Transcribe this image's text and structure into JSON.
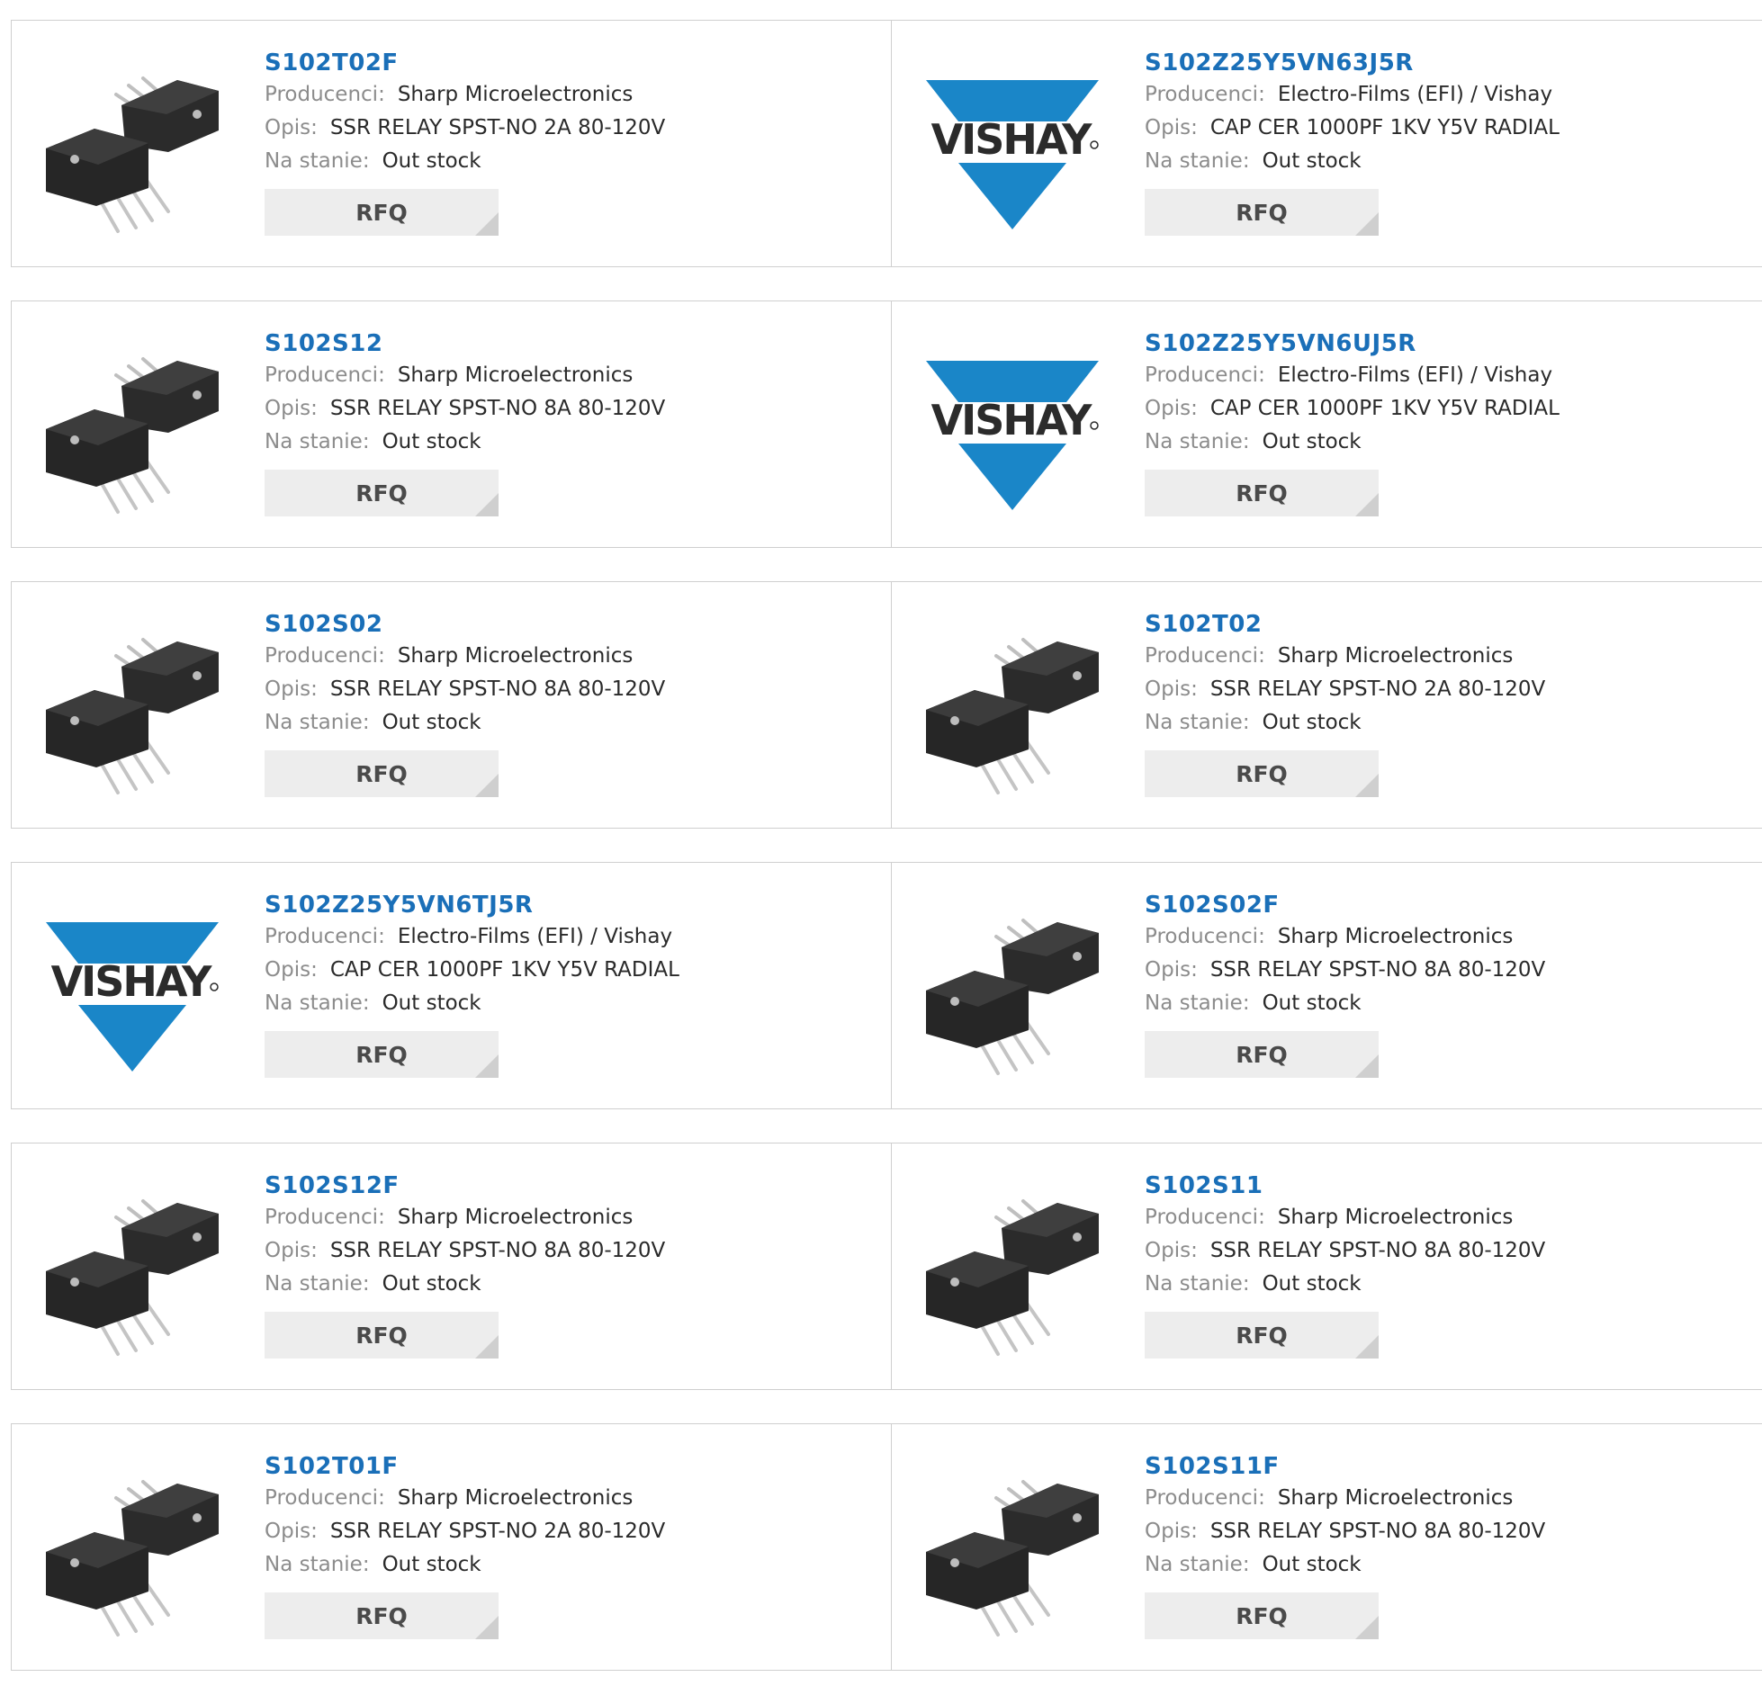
{
  "labels": {
    "producer": "Producenci:",
    "description": "Opis:",
    "stock": "Na stanie:",
    "rfq": "RFQ"
  },
  "brand": {
    "vishay_text": "VISHAY",
    "vishay_blue": "#1a86c8"
  },
  "products": [
    {
      "part": "S102T02F",
      "producer": "Sharp Microelectronics",
      "description": "SSR RELAY SPST-NO 2A 80-120V",
      "stock": "Out stock",
      "image": "relay-package-icon"
    },
    {
      "part": "S102Z25Y5VN63J5R",
      "producer": "Electro-Films (EFI) / Vishay",
      "description": "CAP CER 1000PF 1KV Y5V RADIAL",
      "stock": "Out stock",
      "image": "vishay-logo"
    },
    {
      "part": "S102S12",
      "producer": "Sharp Microelectronics",
      "description": "SSR RELAY SPST-NO 8A 80-120V",
      "stock": "Out stock",
      "image": "relay-package-icon"
    },
    {
      "part": "S102Z25Y5VN6UJ5R",
      "producer": "Electro-Films (EFI) / Vishay",
      "description": "CAP CER 1000PF 1KV Y5V RADIAL",
      "stock": "Out stock",
      "image": "vishay-logo"
    },
    {
      "part": "S102S02",
      "producer": "Sharp Microelectronics",
      "description": "SSR RELAY SPST-NO 8A 80-120V",
      "stock": "Out stock",
      "image": "relay-package-icon"
    },
    {
      "part": "S102T02",
      "producer": "Sharp Microelectronics",
      "description": "SSR RELAY SPST-NO 2A 80-120V",
      "stock": "Out stock",
      "image": "relay-package-icon"
    },
    {
      "part": "S102Z25Y5VN6TJ5R",
      "producer": "Electro-Films (EFI) / Vishay",
      "description": "CAP CER 1000PF 1KV Y5V RADIAL",
      "stock": "Out stock",
      "image": "vishay-logo"
    },
    {
      "part": "S102S02F",
      "producer": "Sharp Microelectronics",
      "description": "SSR RELAY SPST-NO 8A 80-120V",
      "stock": "Out stock",
      "image": "relay-package-icon"
    },
    {
      "part": "S102S12F",
      "producer": "Sharp Microelectronics",
      "description": "SSR RELAY SPST-NO 8A 80-120V",
      "stock": "Out stock",
      "image": "relay-package-icon"
    },
    {
      "part": "S102S11",
      "producer": "Sharp Microelectronics",
      "description": "SSR RELAY SPST-NO 8A 80-120V",
      "stock": "Out stock",
      "image": "relay-package-icon"
    },
    {
      "part": "S102T01F",
      "producer": "Sharp Microelectronics",
      "description": "SSR RELAY SPST-NO 2A 80-120V",
      "stock": "Out stock",
      "image": "relay-package-icon"
    },
    {
      "part": "S102S11F",
      "producer": "Sharp Microelectronics",
      "description": "SSR RELAY SPST-NO 8A 80-120V",
      "stock": "Out stock",
      "image": "relay-package-icon"
    }
  ]
}
